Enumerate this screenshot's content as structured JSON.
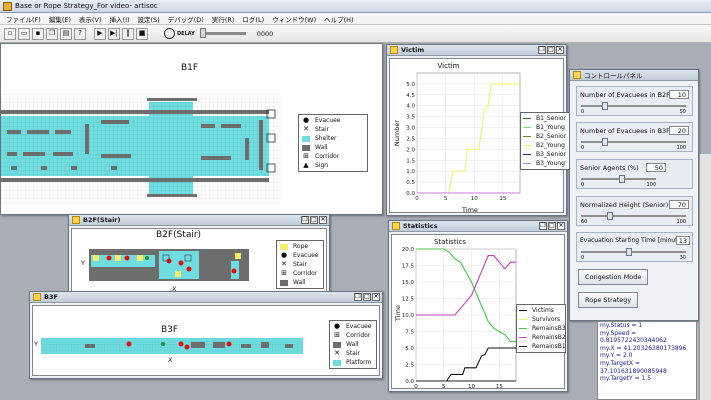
{
  "app": {
    "title": "Base or Rope Strategy_For video- artisoc"
  },
  "menu": [
    "ファイル(F)",
    "編集(E)",
    "表示(V)",
    "挿入(I)",
    "設定(S)",
    "デバッグ(D)",
    "実行(R)",
    "ログ(L)",
    "ウィンドウ(W)",
    "ヘルプ(H)"
  ],
  "toolbar": {
    "speed_label": "DELAY",
    "step": "0000"
  },
  "b1f": {
    "title": "B1F",
    "legend": [
      "Evacuee",
      "Stair",
      "Shelter",
      "Wall",
      "Corridor",
      "Sign"
    ]
  },
  "b2f": {
    "window_title": "B2F(Stair)",
    "title": "B2F(Stair)",
    "y_label": "Y",
    "x_label": "X",
    "legend": [
      "Rope",
      "Evacuee",
      "Stair",
      "Corridor",
      "Wall"
    ]
  },
  "b3f": {
    "window_title": "B3F",
    "title": "B3F",
    "y_label": "Y",
    "x_label": "X",
    "legend": [
      "Evacuee",
      "Corridor",
      "Wall",
      "Stair",
      "Platform"
    ]
  },
  "victim": {
    "window_title": "Victim",
    "chart_title": "Victim",
    "xlabel": "Time",
    "ylabel": "Number",
    "legend": [
      "B1_Senior",
      "B1_Young",
      "B2_Senior",
      "B2_Young",
      "B3_Senior",
      "B3_Young"
    ]
  },
  "statistics": {
    "window_title": "Statistics",
    "chart_title": "Statistics",
    "xlabel": "",
    "ylabel": "Time",
    "legend": [
      "Victims",
      "Survivors",
      "RemainsB3",
      "RemainsB2",
      "RemainsB1"
    ]
  },
  "control": {
    "window_title": "コントロールパネル",
    "sliders": [
      {
        "label": "Number of Evacuees in B2F",
        "value": "10",
        "min": "0",
        "max": "50",
        "frac": 0.2
      },
      {
        "label": "Number of Evacuees in B3F",
        "value": "20",
        "min": "0",
        "max": "100",
        "frac": 0.2
      },
      {
        "label": "Senior Agents (%)",
        "value": "50",
        "min": "0",
        "max": "100",
        "frac": 0.5
      },
      {
        "label": "Normalized Height (Senior) (%)",
        "value": "70",
        "min": "60",
        "max": "100",
        "frac": 0.25
      },
      {
        "label": "Evacuation Starting Time [minutes]",
        "value": "13",
        "min": "0",
        "max": "30",
        "frac": 0.43
      }
    ],
    "buttons": [
      "Congestion Mode",
      "Rope Strategy"
    ]
  },
  "console": [
    "my.Status = 1",
    "my.Speed =",
    "0.8195722430344062",
    "my.X = 41.20326380173896",
    "my.Y = 2.0",
    "my.TargetX =",
    "37.101631890085948",
    "my.TargetY = 1.5"
  ],
  "colors": {
    "shelter": "#6fdde0",
    "wall": "#6d6d6d",
    "rope": "#f6ee6a",
    "accent": "#ffd34a"
  },
  "chart_data": [
    {
      "type": "line",
      "title": "Victim",
      "xlabel": "Time",
      "ylabel": "Number",
      "xlim": [
        0,
        18
      ],
      "ylim": [
        0,
        5.5
      ],
      "x_ticks": [
        0,
        5,
        10,
        15
      ],
      "y_ticks": [
        0.0,
        0.5,
        1.0,
        1.5,
        2.0,
        2.5,
        3.0,
        3.5,
        4.0,
        4.5,
        5.0
      ],
      "series": [
        {
          "name": "B1_Senior",
          "color": "#1b6e1b",
          "x": [
            0,
            18
          ],
          "y": [
            0,
            0
          ]
        },
        {
          "name": "B1_Young",
          "color": "#7adf7a",
          "x": [
            0,
            18
          ],
          "y": [
            0,
            0
          ]
        },
        {
          "name": "B2_Senior",
          "color": "#808020",
          "x": [
            0,
            18
          ],
          "y": [
            0,
            0
          ]
        },
        {
          "name": "B2_Young",
          "color": "#f5ef6a",
          "x": [
            5.5,
            6.3,
            8.4,
            8.8,
            10.8,
            11.8,
            12.4,
            13,
            18
          ],
          "y": [
            0,
            1,
            1,
            2,
            2,
            3.8,
            4,
            5,
            5
          ]
        },
        {
          "name": "B3_Senior",
          "color": "#5a1a8a",
          "x": [
            0,
            18
          ],
          "y": [
            0,
            0
          ]
        },
        {
          "name": "B3_Young",
          "color": "#c87ae0",
          "x": [
            0,
            18
          ],
          "y": [
            0,
            0
          ]
        }
      ]
    },
    {
      "type": "line",
      "title": "Statistics",
      "ylabel": "Time",
      "xlim": [
        0,
        18
      ],
      "ylim": [
        0,
        20
      ],
      "x_ticks": [
        0,
        5,
        10,
        15
      ],
      "y_ticks": [
        0.0,
        2.5,
        5.0,
        7.5,
        10.0,
        12.5,
        15.0,
        17.5,
        20.0
      ],
      "series": [
        {
          "name": "Victims",
          "color": "#111111",
          "x": [
            0,
            5.5,
            6.3,
            8.4,
            8.8,
            10.8,
            11.8,
            12.4,
            13,
            18
          ],
          "y": [
            0,
            0,
            1,
            1,
            2,
            2,
            3.8,
            4,
            5,
            5
          ]
        },
        {
          "name": "Survivors",
          "color": "#f5ef6a",
          "x": [
            0,
            18
          ],
          "y": [
            0,
            0
          ]
        },
        {
          "name": "RemainsB3",
          "color": "#47c447",
          "x": [
            0,
            5,
            6,
            7,
            8,
            9,
            10,
            11,
            12,
            13,
            14,
            15,
            16,
            17,
            18
          ],
          "y": [
            20,
            20,
            19.5,
            18.5,
            18,
            16.5,
            15,
            13,
            11,
            9,
            8,
            7.5,
            7,
            6,
            6
          ]
        },
        {
          "name": "RemainsB2",
          "color": "#c040c0",
          "x": [
            0,
            5,
            7,
            8,
            9,
            10,
            11,
            12,
            13,
            14,
            15,
            16,
            17,
            18
          ],
          "y": [
            10,
            10,
            10,
            11,
            12,
            13,
            15,
            17,
            19,
            19,
            18,
            17,
            18,
            18
          ]
        },
        {
          "name": "RemainsB1",
          "color": "#222222",
          "x": [
            0,
            18
          ],
          "y": [
            0,
            0
          ]
        }
      ]
    }
  ]
}
